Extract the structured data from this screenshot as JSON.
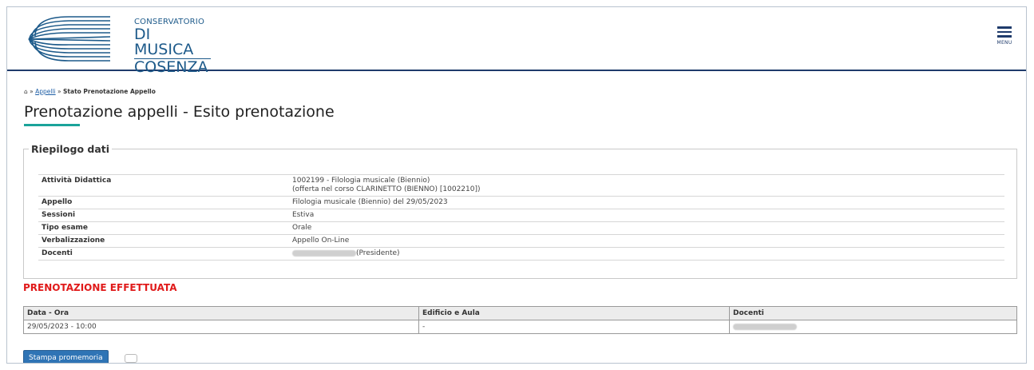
{
  "header": {
    "logo_line1": "CONSERVATORIO",
    "logo_line2": "DI MUSICA",
    "logo_line3": "COSENZA",
    "menu_label": "MENU",
    "accent": "#1f3b6b"
  },
  "breadcrumb": {
    "home_icon": "home-icon",
    "sep1": " » ",
    "link": "Appelli",
    "sep2": " » ",
    "current": "Stato Prenotazione Appello"
  },
  "page_title": "Prenotazione appelli - Esito prenotazione",
  "summary": {
    "legend": "Riepilogo dati",
    "rows": [
      {
        "label": "Attività Didattica",
        "value": "1002199 - Filologia musicale (Biennio)",
        "value2": "(offerta nel corso CLARINETTO (BIENNO) [1002210])"
      },
      {
        "label": "Appello",
        "value": "Filologia musicale (Biennio) del 29/05/2023"
      },
      {
        "label": "Sessioni",
        "value": "Estiva"
      },
      {
        "label": "Tipo esame",
        "value": "Orale"
      },
      {
        "label": "Verbalizzazione",
        "value": "Appello On-Line"
      },
      {
        "label": "Docenti",
        "value": "(Presidente)"
      }
    ]
  },
  "status": {
    "text": "PRENOTAZIONE EFFETTUATA",
    "color": "#e01a1a"
  },
  "slots": {
    "headers": [
      "Data - Ora",
      "Edificio e Aula",
      "Docenti"
    ],
    "rows": [
      [
        "29/05/2023 - 10:00",
        "-",
        ""
      ]
    ]
  },
  "buttons": {
    "print": "Stampa promemoria"
  }
}
